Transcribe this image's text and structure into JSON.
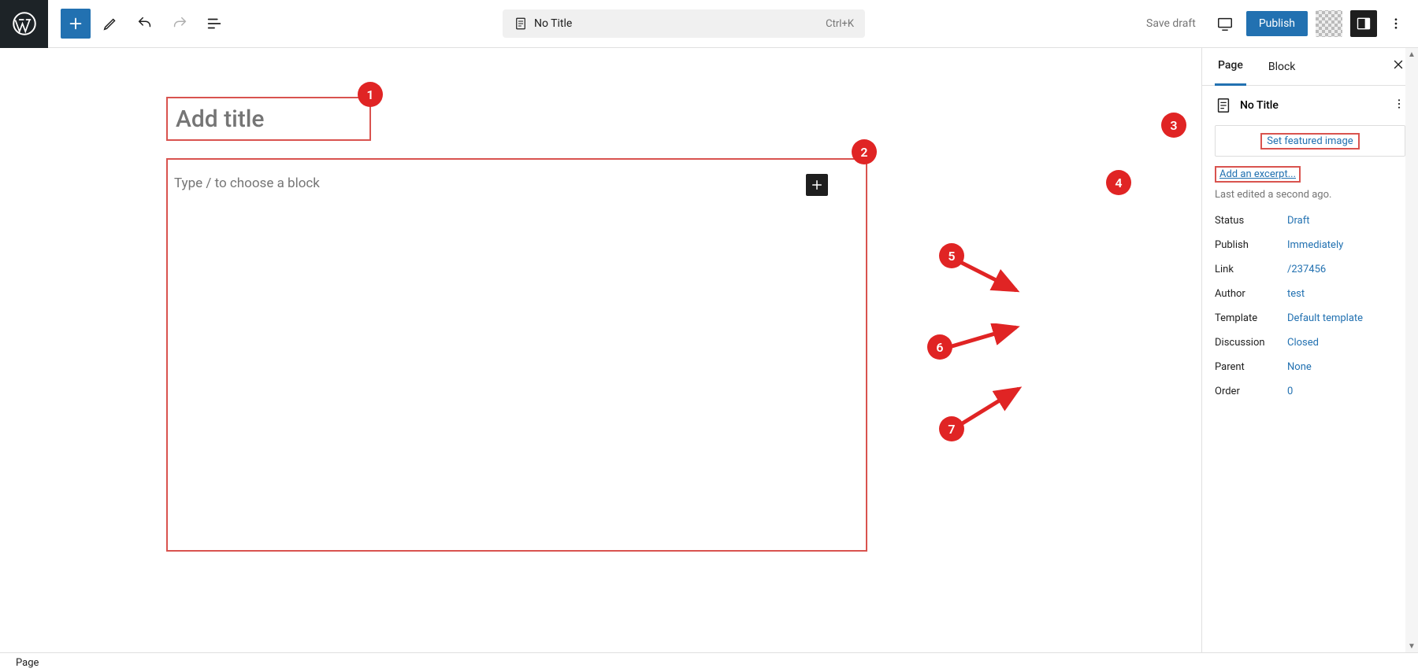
{
  "topbar": {
    "title_pill_text": "No Title",
    "shortcut": "Ctrl+K",
    "save_draft": "Save draft",
    "publish": "Publish"
  },
  "editor": {
    "title_placeholder": "Add title",
    "content_placeholder": "Type / to choose a block"
  },
  "sidebar": {
    "tabs": {
      "page": "Page",
      "block": "Block"
    },
    "doc_title": "No Title",
    "featured_image": "Set featured image",
    "excerpt": "Add an excerpt...",
    "last_edited": "Last edited a second ago.",
    "meta": [
      {
        "label": "Status",
        "value": "Draft"
      },
      {
        "label": "Publish",
        "value": "Immediately"
      },
      {
        "label": "Link",
        "value": "/237456"
      },
      {
        "label": "Author",
        "value": "test"
      },
      {
        "label": "Template",
        "value": "Default template"
      },
      {
        "label": "Discussion",
        "value": "Closed"
      },
      {
        "label": "Parent",
        "value": "None"
      },
      {
        "label": "Order",
        "value": "0"
      }
    ]
  },
  "footer": {
    "breadcrumb": "Page"
  },
  "annotations": {
    "badges": [
      "1",
      "2",
      "3",
      "4",
      "5",
      "6",
      "7"
    ]
  }
}
